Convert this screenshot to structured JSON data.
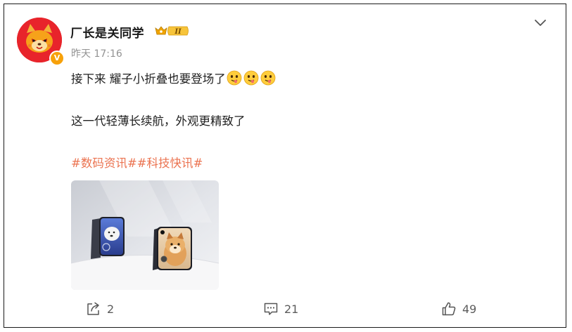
{
  "post": {
    "user_name": "厂长是关同学",
    "vip_level": "II",
    "verified_badge": "V",
    "timestamp": "昨天 17:16",
    "line1": "接下来 耀子小折叠也要登场了",
    "emoji_count_shown": 3,
    "line2": "这一代轻薄长续航，外观更精致了",
    "tags": [
      "#数码资讯#",
      "#科技快讯#"
    ],
    "image_alt": "two foldable phones",
    "icons": {
      "menu": "chevron-down-icon",
      "share": "share-icon",
      "comment": "comment-icon",
      "like": "thumbs-up-icon"
    }
  },
  "actions": {
    "share_count": "2",
    "comment_count": "21",
    "like_count": "49"
  },
  "colors": {
    "topic": "#eb7350",
    "avatar_bg": "#e8242b",
    "badge": "#f7a10a"
  }
}
